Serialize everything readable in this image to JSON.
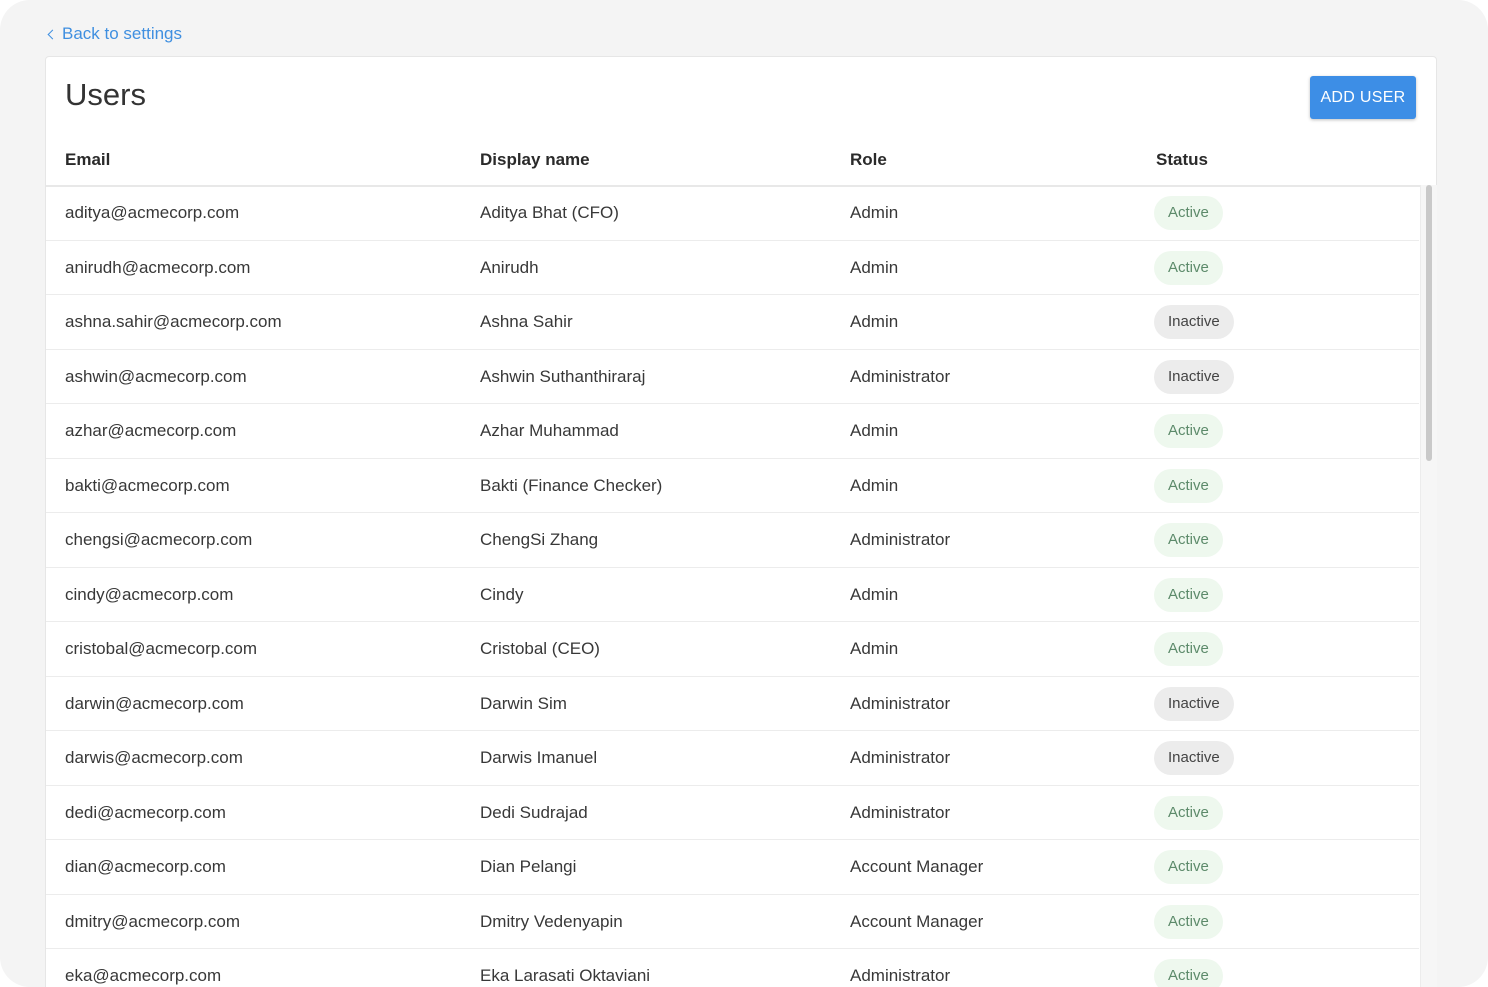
{
  "nav": {
    "back_label": "Back to settings"
  },
  "page": {
    "title": "Users",
    "add_button_label": "ADD USER"
  },
  "table": {
    "columns": [
      "Email",
      "Display name",
      "Role",
      "Status"
    ],
    "rows": [
      {
        "email": "aditya@acmecorp.com",
        "name": "Aditya Bhat (CFO)",
        "role": "Admin",
        "status": "Active"
      },
      {
        "email": "anirudh@acmecorp.com",
        "name": "Anirudh",
        "role": "Admin",
        "status": "Active"
      },
      {
        "email": "ashna.sahir@acmecorp.com",
        "name": "Ashna Sahir",
        "role": "Admin",
        "status": "Inactive"
      },
      {
        "email": "ashwin@acmecorp.com",
        "name": "Ashwin Suthanthiraraj",
        "role": "Administrator",
        "status": "Inactive"
      },
      {
        "email": "azhar@acmecorp.com",
        "name": "Azhar Muhammad",
        "role": "Admin",
        "status": "Active"
      },
      {
        "email": "bakti@acmecorp.com",
        "name": "Bakti (Finance Checker)",
        "role": "Admin",
        "status": "Active"
      },
      {
        "email": "chengsi@acmecorp.com",
        "name": "ChengSi Zhang",
        "role": "Administrator",
        "status": "Active"
      },
      {
        "email": "cindy@acmecorp.com",
        "name": "Cindy",
        "role": "Admin",
        "status": "Active"
      },
      {
        "email": "cristobal@acmecorp.com",
        "name": "Cristobal (CEO)",
        "role": "Admin",
        "status": "Active"
      },
      {
        "email": "darwin@acmecorp.com",
        "name": "Darwin Sim",
        "role": "Administrator",
        "status": "Inactive"
      },
      {
        "email": "darwis@acmecorp.com",
        "name": "Darwis Imanuel",
        "role": "Administrator",
        "status": "Inactive"
      },
      {
        "email": "dedi@acmecorp.com",
        "name": "Dedi Sudrajad",
        "role": "Administrator",
        "status": "Active"
      },
      {
        "email": "dian@acmecorp.com",
        "name": "Dian Pelangi",
        "role": "Account Manager",
        "status": "Active"
      },
      {
        "email": "dmitry@acmecorp.com",
        "name": "Dmitry Vedenyapin",
        "role": "Account Manager",
        "status": "Active"
      },
      {
        "email": "eka@acmecorp.com",
        "name": "Eka Larasati Oktaviani",
        "role": "Administrator",
        "status": "Active"
      }
    ]
  },
  "colors": {
    "accent": "#3d8ee6",
    "link": "#3f8fe0",
    "active_badge_bg": "#eef8ee",
    "active_badge_text": "#5c8a6a",
    "inactive_badge_bg": "#ececec",
    "inactive_badge_text": "#444444"
  },
  "icons": {
    "back": "chevron-left-icon"
  }
}
